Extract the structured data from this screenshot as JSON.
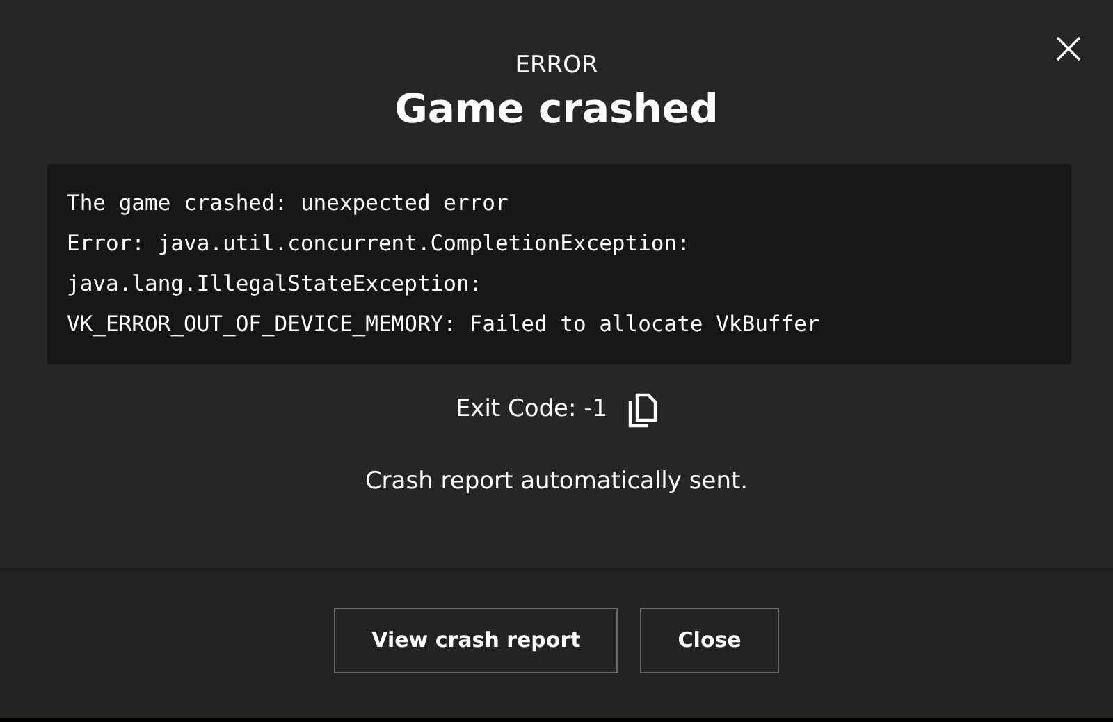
{
  "dialog": {
    "subtitle": "ERROR",
    "title": "Game crashed",
    "log_lines": [
      "The game crashed: unexpected error",
      "Error: java.util.concurrent.CompletionException:",
      "java.lang.IllegalStateException:",
      "VK_ERROR_OUT_OF_DEVICE_MEMORY: Failed to allocate VkBuffer"
    ],
    "exit_code": "Exit Code: -1",
    "status": "Crash report automatically sent.",
    "buttons": [
      "View crash report",
      "Close"
    ]
  }
}
